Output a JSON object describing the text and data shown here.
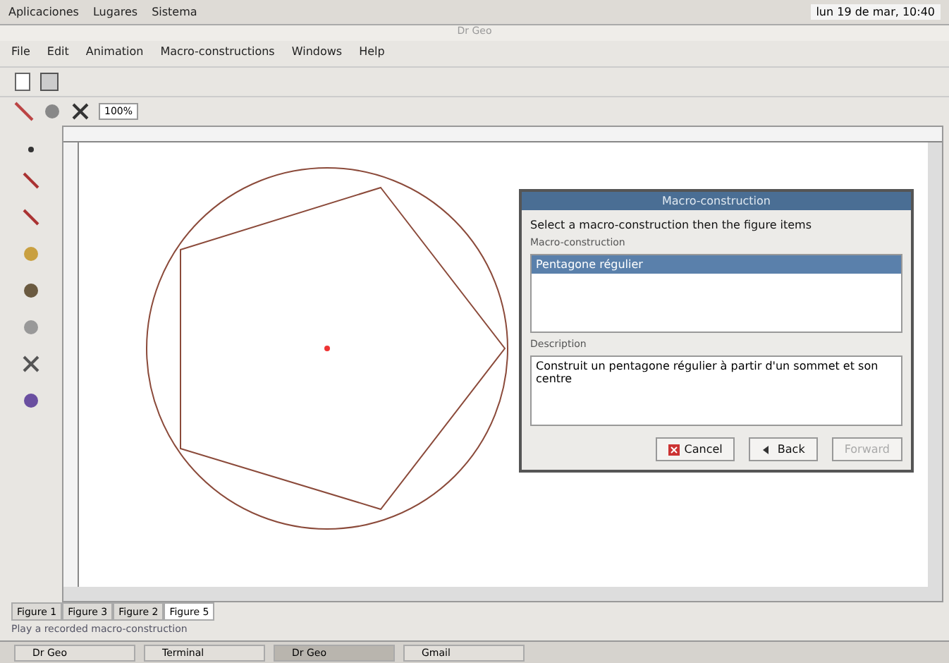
{
  "top_panel": {
    "menus": [
      "Aplicaciones",
      "Lugares",
      "Sistema"
    ],
    "clock": "lun 19 de mar, 10:40"
  },
  "window": {
    "title": "Dr Geo"
  },
  "menu_bar": [
    "File",
    "Edit",
    "Animation",
    "Macro-constructions",
    "Windows",
    "Help"
  ],
  "zoom": {
    "value": "100%"
  },
  "dialog": {
    "title": "Macro-construction",
    "instruction": "Select a macro-construction then the figure items",
    "list_label": "Macro-construction",
    "items": [
      {
        "label": "Pentagone régulier",
        "selected": true
      }
    ],
    "description_label": "Description",
    "description": "Construit un pentagone régulier à partir d'un sommet et son centre",
    "buttons": [
      {
        "label": "Cancel",
        "disabled": false,
        "kind": "cancel"
      },
      {
        "label": "Back",
        "disabled": false,
        "kind": "back"
      },
      {
        "label": "Forward",
        "disabled": true,
        "kind": "forward"
      }
    ]
  },
  "tabs": [
    {
      "label": "Figure 1",
      "selected": false
    },
    {
      "label": "Figure 3",
      "selected": false
    },
    {
      "label": "Figure 2",
      "selected": false
    },
    {
      "label": "Figure 5",
      "selected": true
    }
  ],
  "status_bar": "Play a recorded macro-construction",
  "taskbar": [
    {
      "label": "Dr Geo",
      "selected": false
    },
    {
      "label": "Terminal",
      "selected": false
    },
    {
      "label": "Dr Geo",
      "selected": true
    },
    {
      "label": "Gmail",
      "selected": false
    }
  ]
}
